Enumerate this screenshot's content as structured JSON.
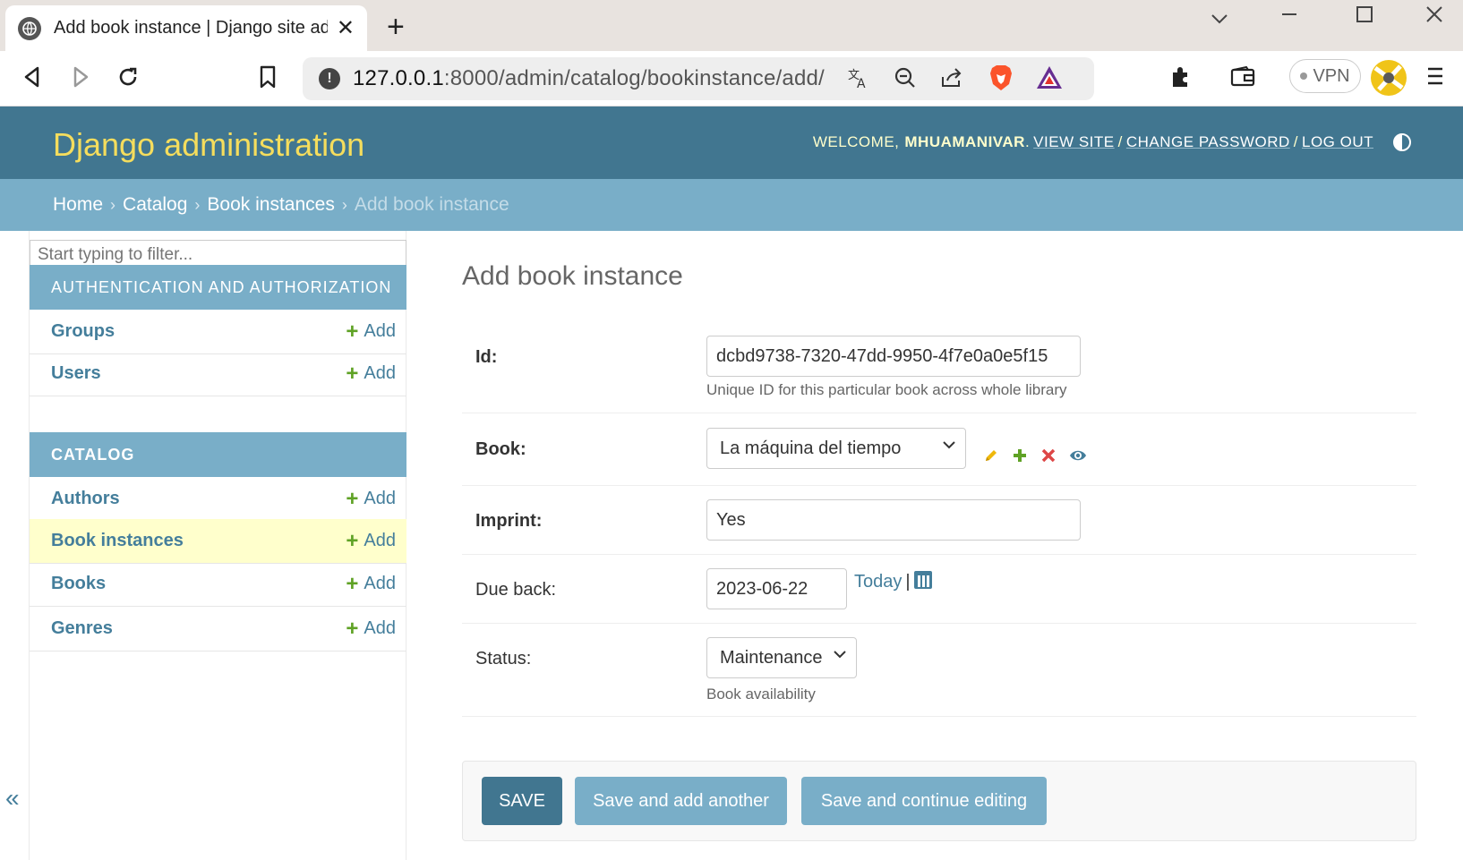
{
  "browser": {
    "tab_title": "Add book instance | Django site admin",
    "new_tab": "+",
    "url_host": "127.0.0.1",
    "url_rest": ":8000/admin/catalog/bookinstance/add/",
    "vpn_label": "VPN"
  },
  "header": {
    "brand": "Django administration",
    "welcome": "WELCOME,",
    "username": "MHUAMANIVAR",
    "view_site": "VIEW SITE",
    "change_password": "CHANGE PASSWORD",
    "log_out": "LOG OUT",
    "sep": "/"
  },
  "breadcrumbs": {
    "home": "Home",
    "catalog": "Catalog",
    "book_instances": "Book instances",
    "current": "Add book instance",
    "sep": "›"
  },
  "sidebar": {
    "filter_placeholder": "Start typing to filter...",
    "auth_caption": "AUTHENTICATION AND AUTHORIZATION",
    "catalog_caption": "CATALOG",
    "add_label": "Add",
    "auth_models": [
      "Groups",
      "Users"
    ],
    "catalog_models": [
      "Authors",
      "Book instances",
      "Books",
      "Genres"
    ],
    "collapse": "«"
  },
  "form": {
    "title": "Add book instance",
    "id_label": "Id:",
    "id_value": "dcbd9738-7320-47dd-9950-4f7e0a0e5f15",
    "id_help": "Unique ID for this particular book across whole library",
    "book_label": "Book:",
    "book_value": "La máquina del tiempo",
    "imprint_label": "Imprint:",
    "imprint_value": "Yes",
    "due_back_label": "Due back:",
    "due_back_value": "2023-06-22",
    "today_link": "Today",
    "today_sep": "|",
    "status_label": "Status:",
    "status_value": "Maintenance",
    "status_help": "Book availability"
  },
  "buttons": {
    "save": "SAVE",
    "save_add": "Save and add another",
    "save_continue": "Save and continue editing"
  },
  "colors": {
    "header_bg": "#417690",
    "brand": "#f5dd5d",
    "breadcrumbs_bg": "#79aec8",
    "link": "#447e9b",
    "add_plus": "#5fa225",
    "current_row": "#ffffcc"
  }
}
